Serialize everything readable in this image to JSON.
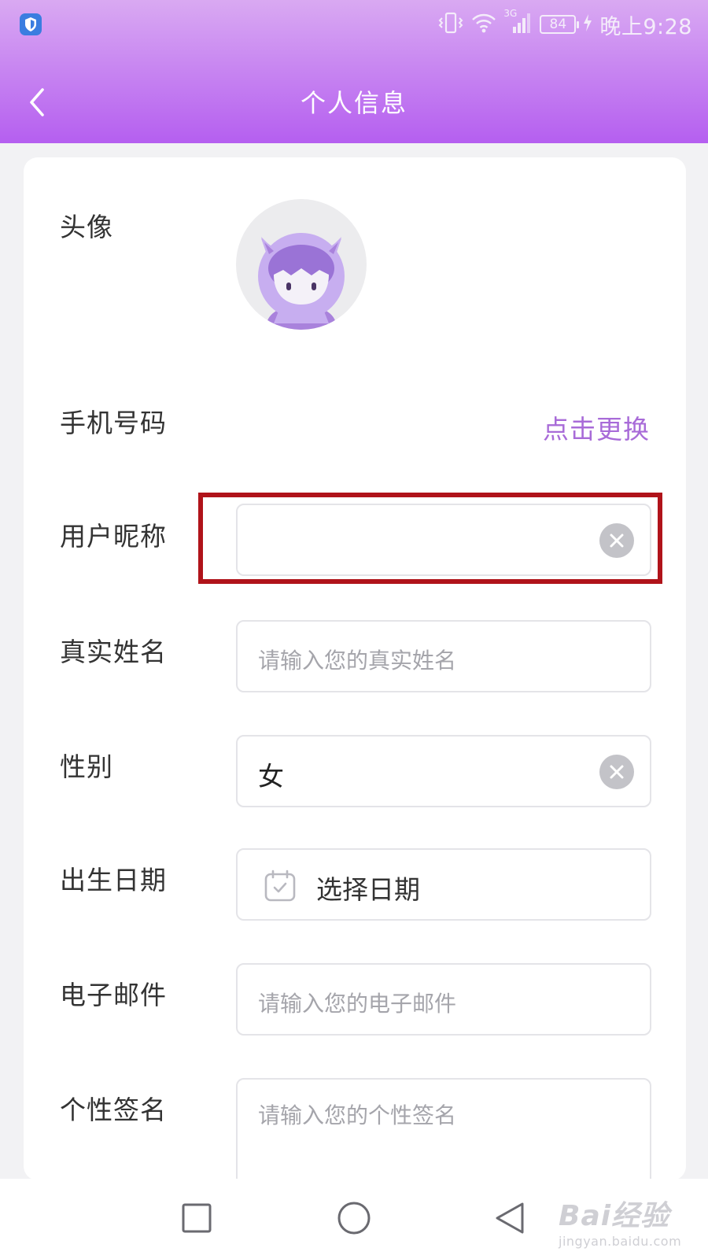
{
  "status_bar": {
    "battery_level": "84",
    "network_label": "3G",
    "time": "晚上9:28"
  },
  "header": {
    "title": "个人信息"
  },
  "profile": {
    "avatar_label": "头像",
    "phone_label": "手机号码",
    "change_phone_link": "点击更换",
    "nickname_label": "用户昵称",
    "nickname_value": "",
    "real_name_label": "真实姓名",
    "real_name_placeholder": "请输入您的真实姓名",
    "gender_label": "性别",
    "gender_value": "女",
    "birthday_label": "出生日期",
    "birthday_placeholder": "选择日期",
    "email_label": "电子邮件",
    "email_placeholder": "请输入您的电子邮件",
    "signature_label": "个性签名",
    "signature_placeholder": "请输入您的个性签名"
  },
  "watermark": {
    "main": "Bai经验",
    "sub": "jingyan.baidu.com"
  },
  "colors": {
    "header_gradient_top": "#d9a9f2",
    "header_gradient_bottom": "#b55ff0",
    "link": "#a86bd8",
    "highlight_box": "#b0131a"
  },
  "icons": [
    "shield-icon",
    "vibrate-icon",
    "wifi-icon",
    "signal-icon",
    "battery-icon",
    "charging-icon",
    "back-arrow-icon",
    "avatar-cat-icon",
    "clear-icon",
    "calendar-icon",
    "recent-apps-icon",
    "home-icon",
    "back-triangle-icon"
  ]
}
